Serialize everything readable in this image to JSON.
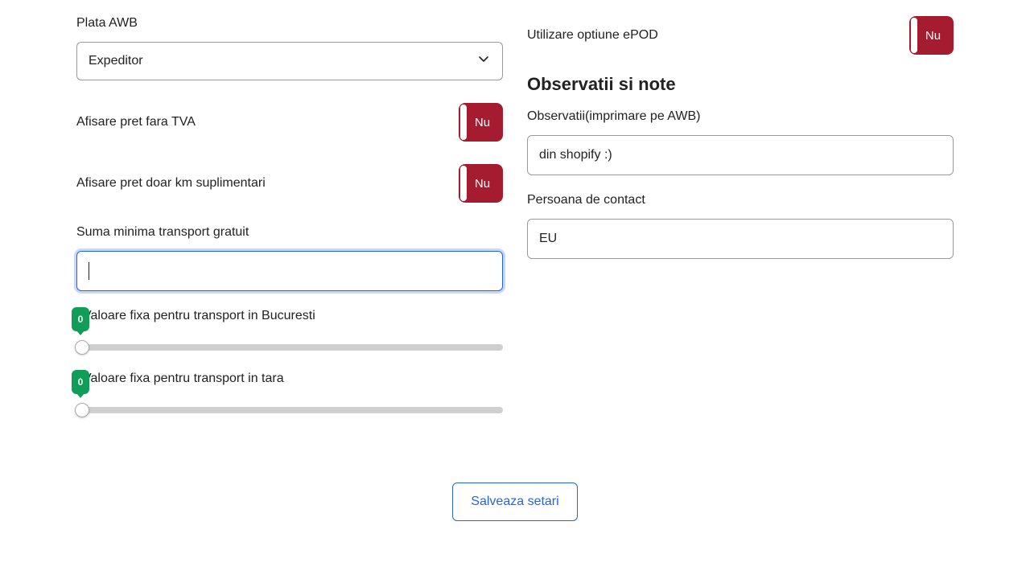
{
  "left": {
    "plata_awb_label": "Plata AWB",
    "plata_awb_value": "Expeditor",
    "afisare_pret_fara_tva": {
      "label": "Afisare pret fara TVA",
      "state": "Nu"
    },
    "afisare_pret_km": {
      "label": "Afisare pret doar km suplimentari",
      "state": "Nu"
    },
    "suma_minima_label": "Suma minima transport gratuit",
    "suma_minima_value": "",
    "slider_bucuresti": {
      "label": "Valoare fixa pentru transport in Bucuresti",
      "value": "0"
    },
    "slider_tara": {
      "label": "Valoare fixa pentru transport in tara",
      "value": "0"
    }
  },
  "right": {
    "epod": {
      "label": "Utilizare optiune ePOD",
      "state": "Nu"
    },
    "section_heading": "Observatii si note",
    "observatii_label": "Observatii(imprimare pe AWB)",
    "observatii_value": "din shopify :)",
    "persoana_label": "Persoana de contact",
    "persoana_value": "EU"
  },
  "footer": {
    "save": "Salveaza setari"
  }
}
